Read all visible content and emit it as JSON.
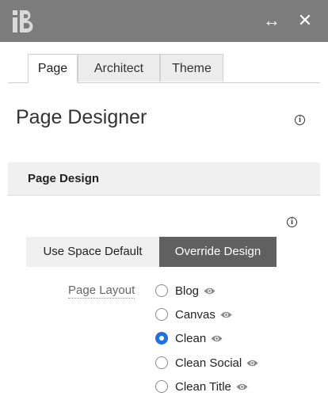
{
  "titlebar": {
    "logo_icon": "ib-logo-icon",
    "expand_glyph": "↔",
    "close_glyph": "✕",
    "background": "#7c7c7c"
  },
  "tabs": [
    {
      "label": "Page",
      "active": true
    },
    {
      "label": "Architect",
      "active": false
    },
    {
      "label": "Theme",
      "active": false
    }
  ],
  "page": {
    "title": "Page Designer",
    "info_icon": "info-icon"
  },
  "section": {
    "title": "Page Design"
  },
  "design_toggle": {
    "options": [
      "Use Space Default",
      "Override Design"
    ],
    "selected": "Override Design"
  },
  "page_layout": {
    "label": "Page Layout",
    "options": [
      {
        "label": "Blog",
        "checked": false
      },
      {
        "label": "Canvas",
        "checked": false
      },
      {
        "label": "Clean",
        "checked": true
      },
      {
        "label": "Clean Social",
        "checked": false
      },
      {
        "label": "Clean Title",
        "checked": false
      }
    ],
    "preview_icon": "eye-icon",
    "accent": "#1e70e6"
  }
}
